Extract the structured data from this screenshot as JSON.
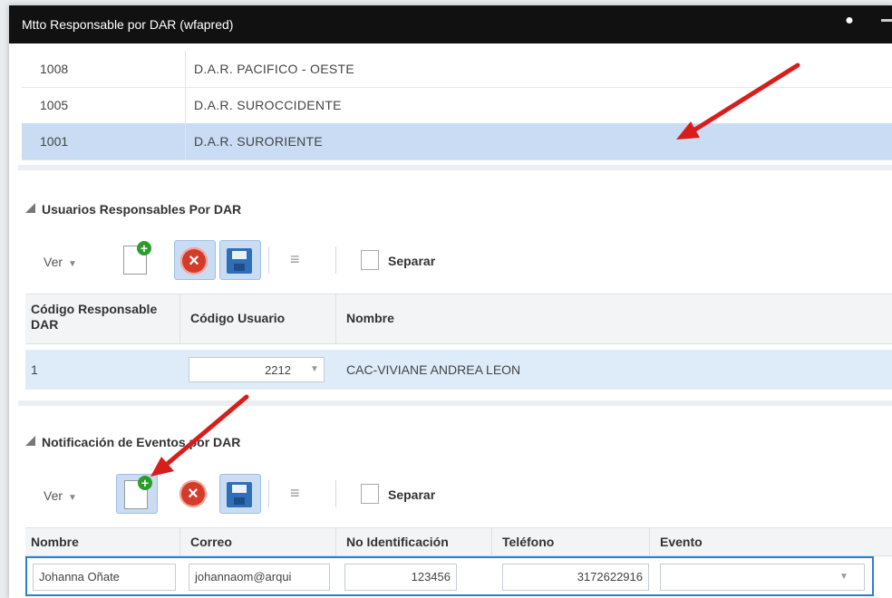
{
  "window": {
    "title": "Mtto Responsable por DAR (wfapred)"
  },
  "dar_list": [
    {
      "code": "1008",
      "name": "D.A.R. PACIFICO - OESTE",
      "selected": false
    },
    {
      "code": "1005",
      "name": "D.A.R. SUROCCIDENTE",
      "selected": false
    },
    {
      "code": "1001",
      "name": "D.A.R. SURORIENTE",
      "selected": true
    }
  ],
  "usuarios": {
    "title": "Usuarios Responsables Por DAR",
    "toolbar": {
      "ver_label": "Ver",
      "separar_label": "Separar"
    },
    "columns": [
      "Código Responsable DAR",
      "Código Usuario",
      "Nombre"
    ],
    "rows": [
      {
        "codigo_responsable": "1",
        "codigo_usuario": "2212",
        "nombre": "CAC-VIVIANE ANDREA LEON"
      }
    ]
  },
  "notificacion": {
    "title": "Notificación de Eventos por DAR",
    "toolbar": {
      "ver_label": "Ver",
      "separar_label": "Separar"
    },
    "columns": [
      "Nombre",
      "Correo",
      "No Identificación",
      "Teléfono",
      "Evento"
    ],
    "rows": [
      {
        "nombre": "Johanna Oñate",
        "correo": "johannaom@arqui",
        "no_identificacion": "123456",
        "telefono": "3172622916",
        "evento": ""
      }
    ]
  },
  "colors": {
    "selected_row": "#c9dcf3",
    "title_bar": "#111111",
    "annotation_arrow": "#d81d1d"
  }
}
